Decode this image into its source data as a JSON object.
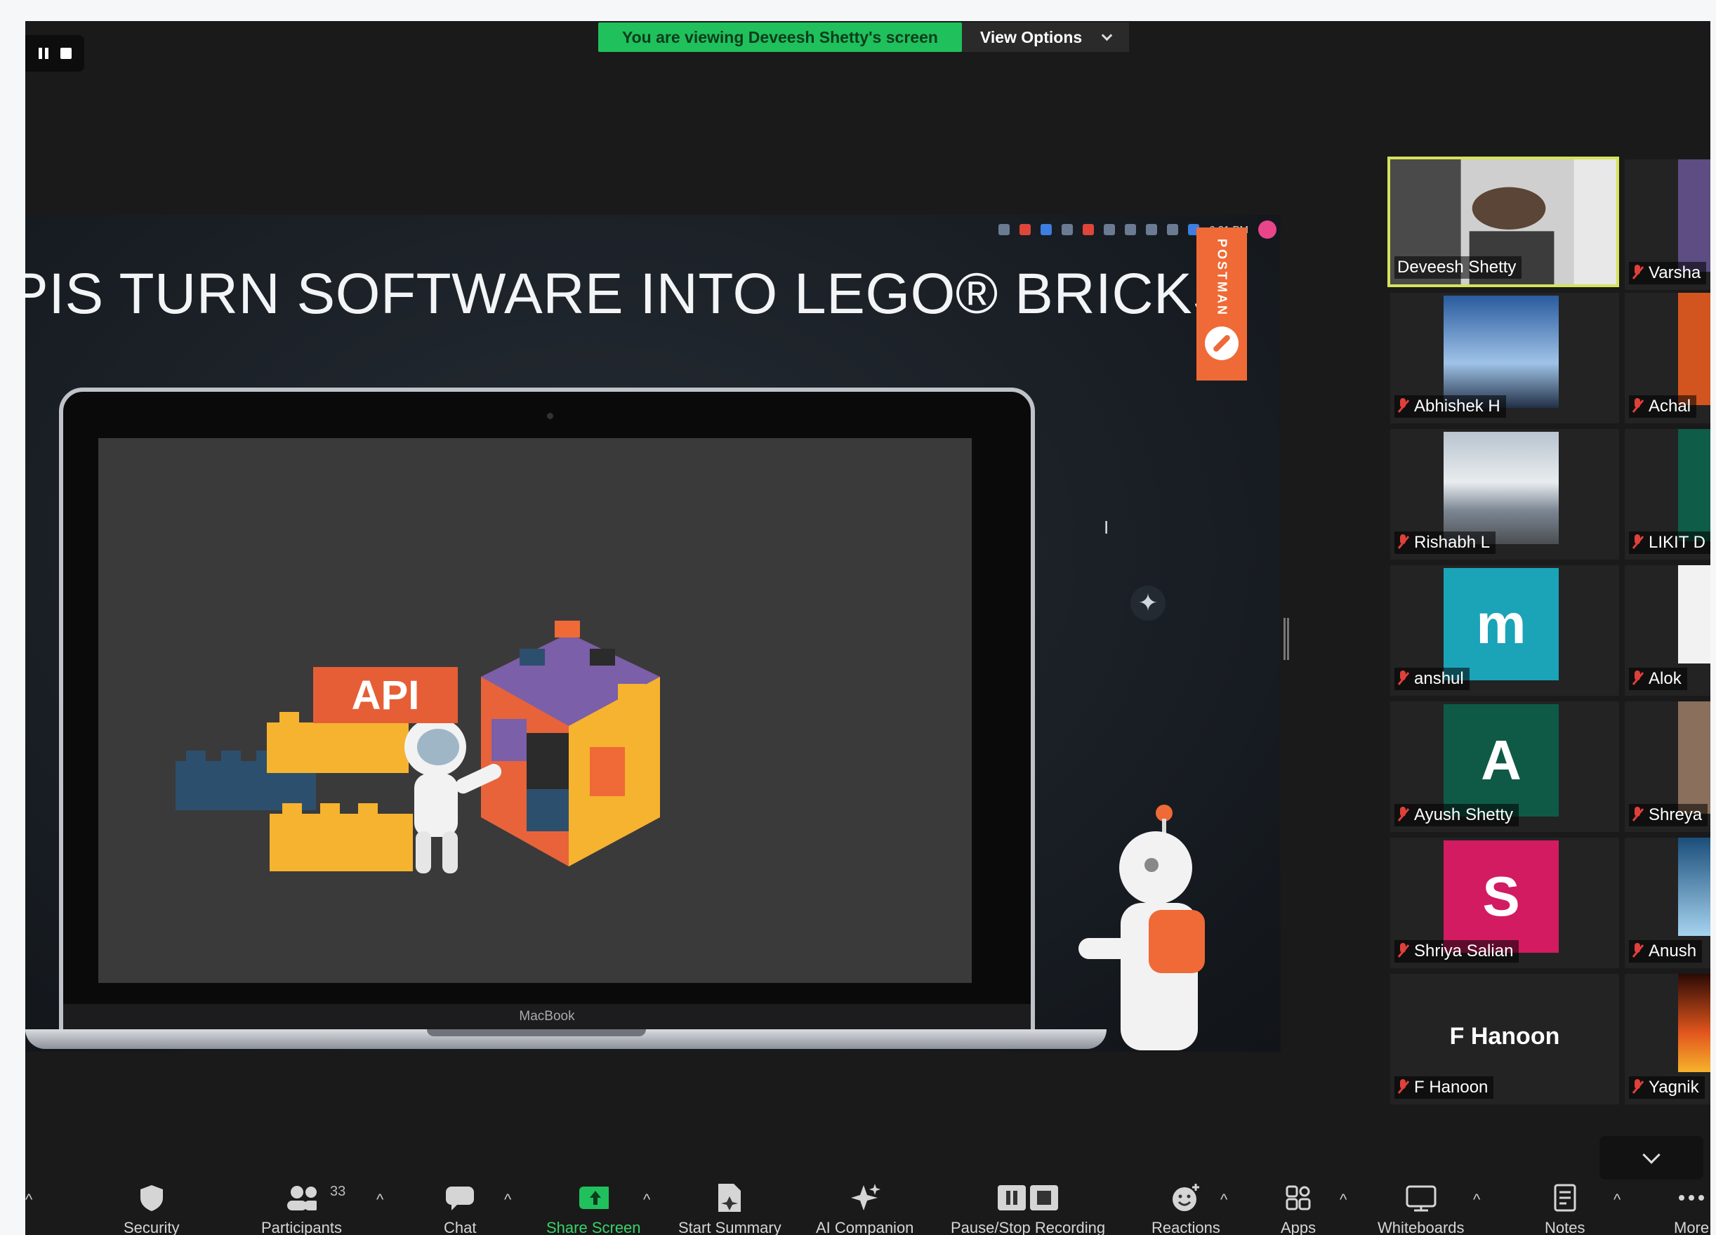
{
  "banner": {
    "viewing_text": "You are viewing Deveesh Shetty's screen",
    "view_options_label": "View Options"
  },
  "shared_screen": {
    "tray_time": "6:21 PM",
    "slide_title": "PIS TURN SOFTWARE INTO LEGO® BRICKS",
    "postman_label": "POSTMAN",
    "api_label": "API",
    "laptop_brand": "MacBook"
  },
  "gallery": {
    "participants": [
      {
        "name": "Deveesh Shetty",
        "type": "video",
        "active": true
      },
      {
        "name": "Varsha",
        "type": "video"
      },
      {
        "name": "Abhishek H",
        "type": "image"
      },
      {
        "name": "Achal",
        "type": "image"
      },
      {
        "name": "Rishabh L",
        "type": "image"
      },
      {
        "name": "LIKIT D",
        "type": "image"
      },
      {
        "name": "anshul",
        "type": "avatar",
        "initial": "m",
        "color": "#1ba3b8"
      },
      {
        "name": "Alok",
        "type": "image"
      },
      {
        "name": "Ayush Shetty",
        "type": "avatar",
        "initial": "A",
        "color": "#0e5a47"
      },
      {
        "name": "Shreya",
        "type": "image"
      },
      {
        "name": "Shriya Salian",
        "type": "avatar",
        "initial": "S",
        "color": "#d31b62"
      },
      {
        "name": "Anush",
        "type": "image"
      },
      {
        "name": "F Hanoon",
        "type": "text",
        "big_name": "F Hanoon"
      },
      {
        "name": "Yagnik",
        "type": "image"
      }
    ]
  },
  "toolbar": {
    "security": "Security",
    "participants": "Participants",
    "participants_count": "33",
    "chat": "Chat",
    "share_screen": "Share Screen",
    "start_summary": "Start Summary",
    "ai_companion": "AI Companion",
    "recording": "Pause/Stop Recording",
    "reactions": "Reactions",
    "apps": "Apps",
    "whiteboards": "Whiteboards",
    "notes": "Notes",
    "more": "More"
  },
  "colors": {
    "banner_green": "#20c05c",
    "active_speaker_border": "#d6e35a",
    "postman_orange": "#ef6a36",
    "share_green": "#3ad16a"
  }
}
